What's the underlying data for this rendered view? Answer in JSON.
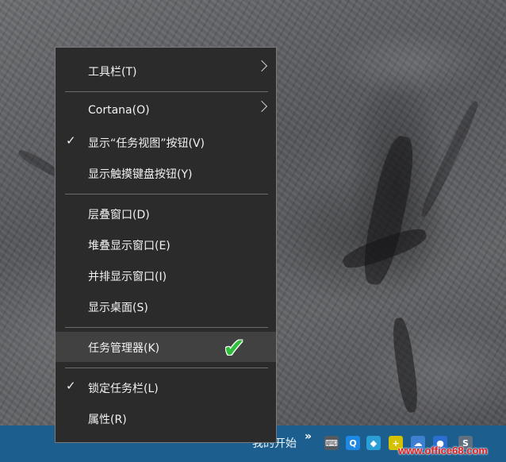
{
  "menu": {
    "items": [
      {
        "label": "工具栏(T)",
        "checked": false,
        "submenu": true
      },
      {
        "label": "Cortana(O)",
        "checked": false,
        "submenu": true
      },
      {
        "label": "显示“任务视图”按钮(V)",
        "checked": true,
        "submenu": false
      },
      {
        "label": "显示触摸键盘按钮(Y)",
        "checked": false,
        "submenu": false
      },
      {
        "label": "层叠窗口(D)",
        "checked": false,
        "submenu": false
      },
      {
        "label": "堆叠显示窗口(E)",
        "checked": false,
        "submenu": false
      },
      {
        "label": "并排显示窗口(I)",
        "checked": false,
        "submenu": false
      },
      {
        "label": "显示桌面(S)",
        "checked": false,
        "submenu": false
      },
      {
        "label": "任务管理器(K)",
        "checked": false,
        "submenu": false,
        "highlighted": true
      },
      {
        "label": "锁定任务栏(L)",
        "checked": true,
        "submenu": false
      },
      {
        "label": "属性(R)",
        "checked": false,
        "submenu": false
      }
    ],
    "check_glyph": "✓",
    "annotation_glyph": "✔"
  },
  "taskbar": {
    "text": "我的开始",
    "overflow_glyph": "»",
    "tray_icons": [
      {
        "name": "keyboard-icon",
        "glyph": "⌨",
        "color": "#555a60"
      },
      {
        "name": "search-app-icon",
        "glyph": "Q",
        "color": "#1e88e5"
      },
      {
        "name": "network-icon",
        "glyph": "◆",
        "color": "#2a9fd6"
      },
      {
        "name": "plus-icon",
        "glyph": "+",
        "color": "#d4c200"
      },
      {
        "name": "cloud-icon",
        "glyph": "☁",
        "color": "#3d7fd0"
      },
      {
        "name": "globe-icon",
        "glyph": "●",
        "color": "#2a6ed0"
      },
      {
        "name": "shield-icon",
        "glyph": "S",
        "color": "#607080"
      }
    ],
    "watermark": "www.office68.com"
  }
}
